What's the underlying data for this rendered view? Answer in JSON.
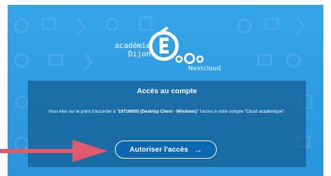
{
  "logo": {
    "academy_line1": "académie",
    "academy_line2": "Dijon",
    "product_name": "Nextcloud"
  },
  "dialog": {
    "title": "Accès au compte",
    "message_prefix": "Vous êtes sur le point d'accorder à \"",
    "client_name": "1971M005 (Desktop Client - Windows)",
    "message_suffix": "\" l'accès à votre compte \"Cloud académique\".",
    "button_label": "Autoriser l'accès",
    "button_icon": "→"
  },
  "colors": {
    "background": "#2f9be0",
    "panel": "#105284",
    "button": "#0a67b0",
    "pointer_arrow": "#e05a6b"
  }
}
